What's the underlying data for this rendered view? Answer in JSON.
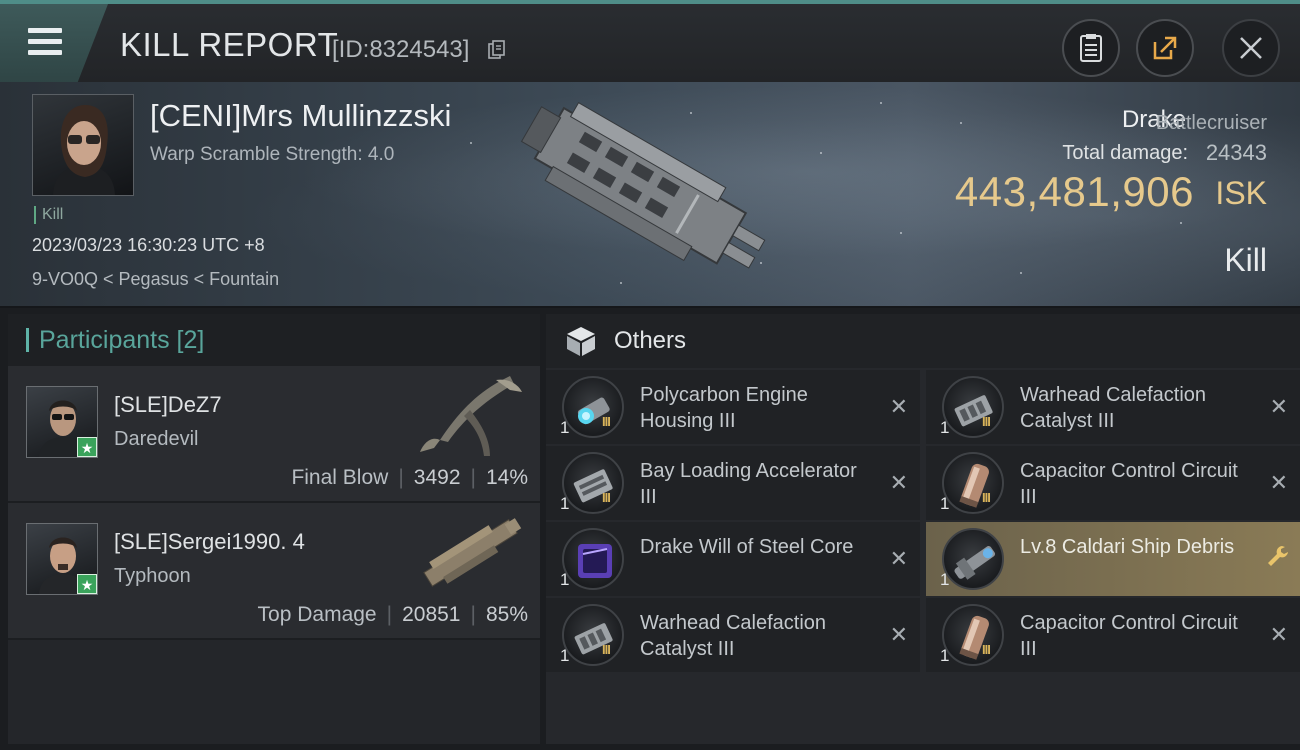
{
  "header": {
    "title": "KILL REPORT",
    "report_id": "[ID:8324543]",
    "icons": [
      "menu-icon",
      "copy-icon",
      "clipboard-icon",
      "share-icon",
      "close-icon"
    ]
  },
  "victim": {
    "name": "[CENI]Mrs Mullinzzski",
    "warp_scramble": "Warp Scramble Strength: 4.0",
    "tag": "Kill",
    "datetime": "2023/03/23 16:30:23 UTC +8",
    "location": "9-VO0Q < Pegasus < Fountain",
    "ship_name": "Drake",
    "ship_class": "Battlecruiser",
    "total_damage_label": "Total damage:",
    "total_damage": "24343",
    "isk_value": "443,481,906",
    "isk_unit": "ISK",
    "report_type": "Kill"
  },
  "participants": {
    "title": "Participants [2]",
    "list": [
      {
        "name": "[SLE]DeZ7",
        "ship": "Daredevil",
        "role": "Final Blow",
        "damage": "3492",
        "percent": "14%"
      },
      {
        "name": "[SLE]Sergei1990. 4",
        "ship": "Typhoon",
        "role": "Top Damage",
        "damage": "20851",
        "percent": "85%"
      }
    ]
  },
  "others": {
    "title": "Others",
    "items": [
      {
        "name": "Polycarbon Engine Housing III",
        "qty": "1",
        "tier": "III",
        "status": "destroyed",
        "icon": "engine-rig-icon"
      },
      {
        "name": "Warhead Calefaction Catalyst III",
        "qty": "1",
        "tier": "III",
        "status": "destroyed",
        "icon": "warhead-rig-icon"
      },
      {
        "name": "Bay Loading Accelerator III",
        "qty": "1",
        "tier": "III",
        "status": "destroyed",
        "icon": "launcher-rig-icon"
      },
      {
        "name": "Capacitor Control Circuit III",
        "qty": "1",
        "tier": "III",
        "status": "destroyed",
        "icon": "capacitor-rig-icon"
      },
      {
        "name": "Drake Will of Steel Core",
        "qty": "1",
        "tier": "",
        "status": "destroyed",
        "icon": "core-icon"
      },
      {
        "name": "Lv.8 Caldari Ship Debris",
        "qty": "1",
        "tier": "",
        "status": "dropped",
        "icon": "debris-icon"
      },
      {
        "name": "Warhead Calefaction Catalyst III",
        "qty": "1",
        "tier": "III",
        "status": "destroyed",
        "icon": "warhead-rig-icon"
      },
      {
        "name": "Capacitor Control Circuit III",
        "qty": "1",
        "tier": "III",
        "status": "destroyed",
        "icon": "capacitor-rig-icon"
      }
    ]
  },
  "colors": {
    "accent_teal": "#5fb3a8",
    "isk_gold": "#e6c98c",
    "highlight_item": "#8a7b56",
    "badge_green": "#3aa35b"
  }
}
